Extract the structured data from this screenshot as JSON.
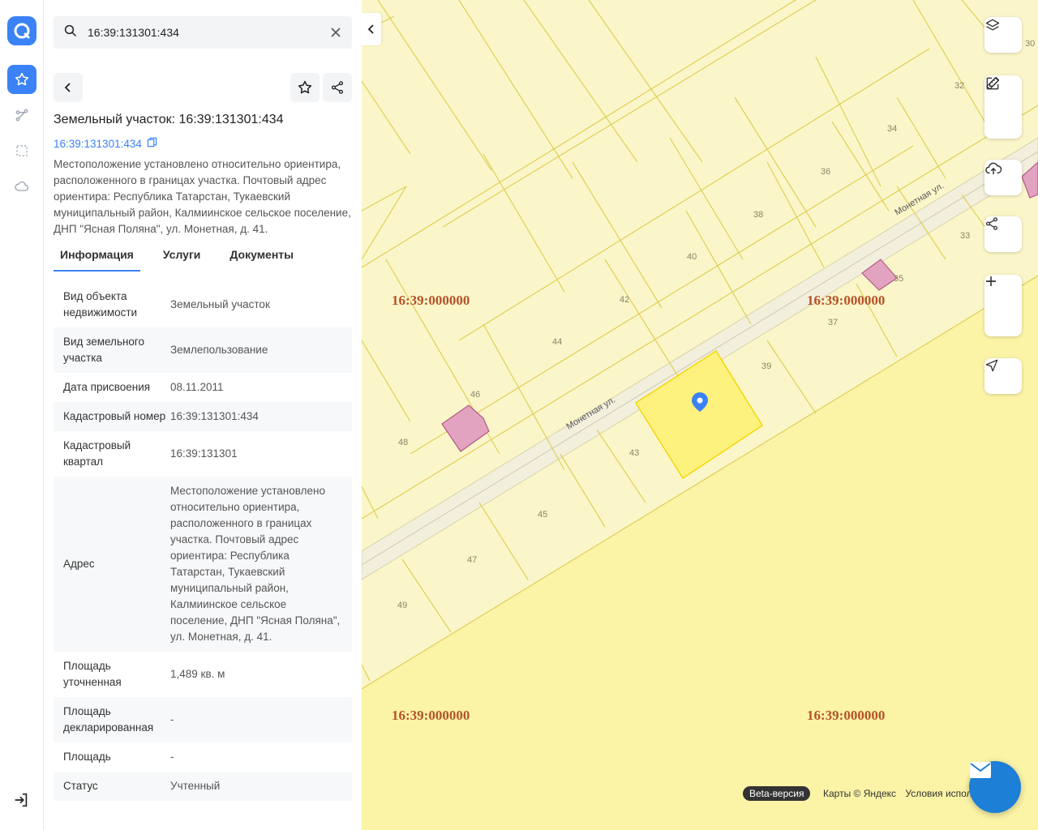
{
  "search": {
    "value": "16:39:131301:434"
  },
  "object": {
    "title": "Земельный участок: 16:39:131301:434",
    "cad_link": "16:39:131301:434",
    "description": "Местоположение установлено относительно ориентира, расположенного в границах участка. Почтовый адрес ориентира: Республика Татарстан, Тукаевский муниципальный район, Калмиинское сельское поселение, ДНП \"Ясная Поляна\", ул. Монетная, д. 41."
  },
  "tabs": [
    {
      "label": "Информация"
    },
    {
      "label": "Услуги"
    },
    {
      "label": "Документы"
    }
  ],
  "info_rows": [
    {
      "key": "Вид объекта недвижимости",
      "value": "Земельный участок"
    },
    {
      "key": "Вид земельного участка",
      "value": "Землепользование"
    },
    {
      "key": "Дата присвоения",
      "value": "08.11.2011"
    },
    {
      "key": "Кадастровый номер",
      "value": "16:39:131301:434"
    },
    {
      "key": "Кадастровый квартал",
      "value": "16:39:131301"
    },
    {
      "key": "Адрес",
      "value": "Местоположение установлено относительно ориентира, расположенного в границах участка. Почтовый адрес ориентира: Республика Татарстан, Тукаевский муниципальный район, Калмиинское сельское поселение, ДНП \"Ясная Поляна\", ул. Монетная, д. 41."
    },
    {
      "key": "Площадь уточненная",
      "value": "1,489 кв. м"
    },
    {
      "key": "Площадь декларированная",
      "value": "-"
    },
    {
      "key": "Площадь",
      "value": "-"
    },
    {
      "key": "Статус",
      "value": "Учтенный"
    }
  ],
  "map": {
    "street_label": "Монетная ул.",
    "quarter_label": "16:39:000000",
    "plot_numbers": [
      "30",
      "32",
      "34",
      "36",
      "38",
      "40",
      "42",
      "44",
      "46",
      "48",
      "33",
      "35",
      "37",
      "39",
      "43",
      "45",
      "47",
      "49"
    ],
    "beta_label": "Beta-версия",
    "copyright": "Карты © Яндекс",
    "terms": "Условия испол"
  },
  "colors": {
    "accent": "#3b82f6",
    "selected_plot": "#fff27a",
    "building": "#e2a3c0"
  }
}
